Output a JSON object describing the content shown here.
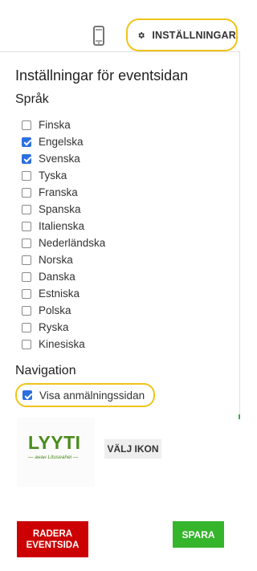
{
  "topbar": {
    "mobile_preview_icon": "mobile-phone-icon",
    "settings_icon": "gear-icon",
    "settings_label": "INSTÄLLNINGAR",
    "highlight_color": "#f0c419"
  },
  "panel": {
    "title": "Inställningar för eventsidan",
    "languages_heading": "Språk",
    "languages": [
      {
        "label": "Finska",
        "checked": false
      },
      {
        "label": "Engelska",
        "checked": true
      },
      {
        "label": "Svenska",
        "checked": true
      },
      {
        "label": "Tyska",
        "checked": false
      },
      {
        "label": "Franska",
        "checked": false
      },
      {
        "label": "Spanska",
        "checked": false
      },
      {
        "label": "Italienska",
        "checked": false
      },
      {
        "label": "Nederländska",
        "checked": false
      },
      {
        "label": "Norska",
        "checked": false
      },
      {
        "label": "Danska",
        "checked": false
      },
      {
        "label": "Estniska",
        "checked": false
      },
      {
        "label": "Polska",
        "checked": false
      },
      {
        "label": "Ryska",
        "checked": false
      },
      {
        "label": "Kinesiska",
        "checked": false
      }
    ],
    "navigation_heading": "Navigation",
    "navigation_option": {
      "label": "Visa anmälningssidan",
      "checked": true
    }
  },
  "logo": {
    "text": "LYYTI",
    "tagline": "— aнан  Lituseahei —",
    "color": "#4b8b1e"
  },
  "buttons": {
    "choose_icon": "VÄLJ IKON",
    "delete_event": "RADERA\nEVENTSIDA",
    "delete_color": "#cc0000",
    "save": "SPARA",
    "save_color": "#35b52c"
  }
}
